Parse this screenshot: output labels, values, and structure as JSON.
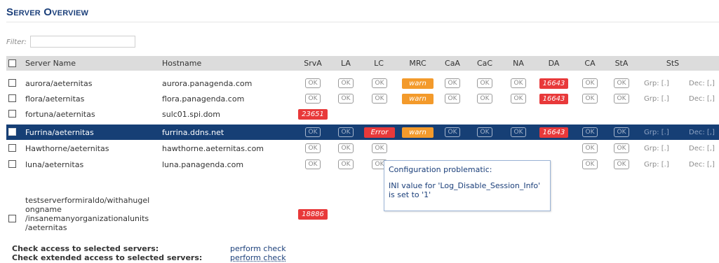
{
  "page": {
    "title": "Server Overview",
    "filter_label": "Filter:",
    "filter_value": ""
  },
  "columns": [
    "Server Name",
    "Hostname",
    "SrvA",
    "LA",
    "LC",
    "MRC",
    "CaA",
    "CaC",
    "NA",
    "DA",
    "CA",
    "StA",
    "StS"
  ],
  "rows": [
    {
      "name": "aurora/aeternitas",
      "host": "aurora.panagenda.com",
      "srva": "OK",
      "la": "OK",
      "lc": "OK",
      "mrc": "warn",
      "caa": "OK",
      "cac": "OK",
      "na": "OK",
      "da": "16643",
      "ca": "OK",
      "sta": "OK",
      "grp": "Grp: [.]",
      "dec": "Dec: [,]"
    },
    {
      "name": "flora/aeternitas",
      "host": "flora.panagenda.com",
      "srva": "OK",
      "la": "OK",
      "lc": "OK",
      "mrc": "warn",
      "caa": "OK",
      "cac": "OK",
      "na": "OK",
      "da": "16643",
      "ca": "OK",
      "sta": "OK",
      "grp": "Grp: [.]",
      "dec": "Dec: [,]"
    },
    {
      "name": "fortuna/aeternitas",
      "host": "sulc01.spi.dom",
      "srva": "23651"
    },
    {
      "name": "Furrina/aeternitas",
      "host": "furrina.ddns.net",
      "srva": "OK",
      "la": "OK",
      "lc": "Error",
      "mrc": "warn",
      "caa": "OK",
      "cac": "OK",
      "na": "OK",
      "da": "16643",
      "ca": "OK",
      "sta": "OK",
      "grp": "Grp: [.]",
      "dec": "Dec: [,]"
    },
    {
      "name": "Hawthorne/aeternitas",
      "host": "hawthorne.aeternitas.com",
      "srva": "OK",
      "la": "OK",
      "lc": "OK",
      "ca": "OK",
      "sta": "OK",
      "grp": "Grp: [.]",
      "dec": "Dec: [,]"
    },
    {
      "name": "luna/aeternitas",
      "host": "luna.panagenda.com",
      "srva": "OK",
      "la": "OK",
      "lc": "OK",
      "ca": "OK",
      "sta": "OK",
      "grp": "Grp: [.]",
      "dec": "Dec: [,]"
    },
    {
      "name_lines": [
        "testserverformiraldo/withahugel",
        "ongname",
        "/insanemanyorganizationalunits",
        "/aeternitas"
      ],
      "srva": "18886"
    }
  ],
  "tooltip": {
    "heading": "Configuration problematic:",
    "body": "INI value for 'Log_Disable_Session_Info' is set to '1'"
  },
  "footer": {
    "access_label": "Check access to selected servers:",
    "access_link": "perform check",
    "extended_label": "Check extended access to selected servers:",
    "extended_link": "perform check"
  },
  "colors": {
    "title": "#1b3f7a",
    "selected_row": "#163f75",
    "warn": "#f39a2b",
    "error": "#e8393a",
    "header_bg": "#dcdcdc"
  }
}
